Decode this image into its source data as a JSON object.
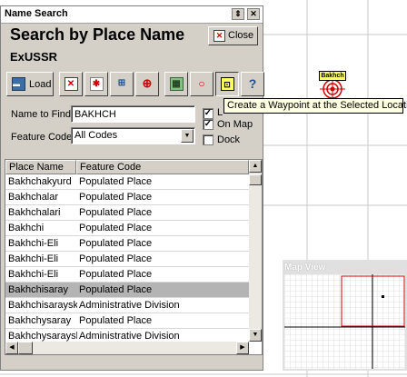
{
  "window": {
    "title": "Name Search",
    "heading": "Search by Place Name",
    "close_label": "Close",
    "database": "ExUSSR",
    "titlebar_buttons": [
      "⇕",
      "✕"
    ]
  },
  "toolbar": {
    "load_label": "Load",
    "buttons": [
      {
        "icon": "load-icon"
      },
      {
        "icon": "delete-document-icon"
      },
      {
        "icon": "document-star-icon"
      },
      {
        "icon": "network-icon"
      },
      {
        "icon": "target-icon"
      },
      {
        "icon": "map-icon"
      },
      {
        "icon": "circle-icon"
      },
      {
        "icon": "waypoint-icon"
      },
      {
        "icon": "help-icon"
      }
    ]
  },
  "search": {
    "name_label": "Name to Find",
    "name_value": "BAKHCH",
    "feature_label": "Feature Code",
    "feature_value": "All Codes"
  },
  "checkboxes": [
    {
      "label": "L",
      "checked": true
    },
    {
      "label": "On Map",
      "checked": true
    },
    {
      "label": "Dock",
      "checked": false
    }
  ],
  "tooltip": "Create a Waypoint at the Selected Location",
  "table": {
    "columns": [
      "Place Name",
      "Feature Code"
    ],
    "rows": [
      {
        "name": "Bakhchakyurd",
        "code": "Populated Place"
      },
      {
        "name": "Bakhchalar",
        "code": "Populated Place"
      },
      {
        "name": "Bakhchalari",
        "code": "Populated Place"
      },
      {
        "name": "Bakhchi",
        "code": "Populated Place"
      },
      {
        "name": "Bakhchi-Eli",
        "code": "Populated Place"
      },
      {
        "name": "Bakhchi-Eli",
        "code": "Populated Place"
      },
      {
        "name": "Bakhchi-Eli",
        "code": "Populated Place"
      },
      {
        "name": "Bakhchisaray",
        "code": "Populated Place",
        "selected": true
      },
      {
        "name": "Bakhchisaraysk",
        "code": "Administrative Division"
      },
      {
        "name": "Bakhchysaray",
        "code": "Populated Place"
      },
      {
        "name": "Bakhchysaraysk",
        "code": "Administrative Division"
      }
    ]
  },
  "map": {
    "marker_label": "Bakhch",
    "map_view_title": "Map View"
  },
  "colors": {
    "selection": "#b4b4b4",
    "tooltip_bg": "#ffffe1",
    "marker": "#d00000",
    "window_bg": "#d4d0c8"
  }
}
